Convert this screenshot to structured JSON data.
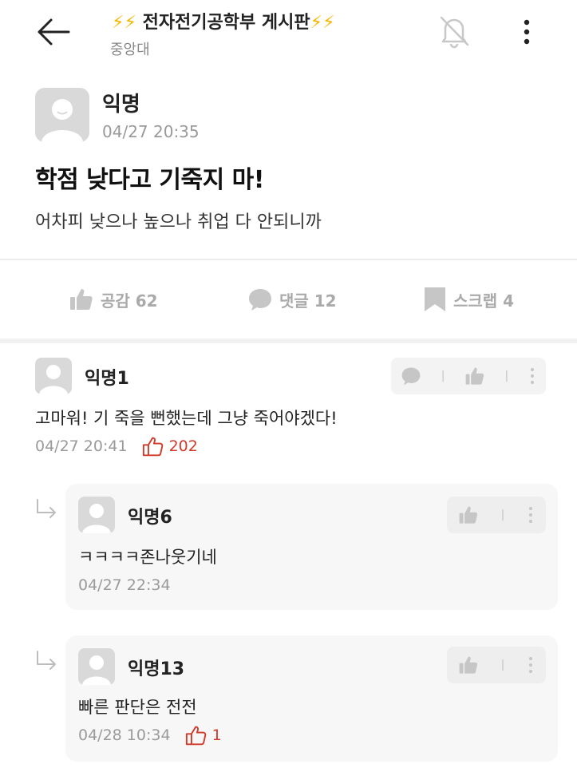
{
  "header": {
    "bolt": "⚡",
    "board_title": "전자전기공학부 게시판",
    "school": "중앙대"
  },
  "post": {
    "author": "익명",
    "time": "04/27 20:35",
    "title": "학점 낮다고 기죽지 마!",
    "body": "어차피 낮으나 높으나 취업 다 안되니까"
  },
  "actions": {
    "like": "공감 62",
    "comment": "댓글 12",
    "scrap": "스크랩 4"
  },
  "comments": [
    {
      "author": "익명1",
      "text": "고마워! 기 죽을 뻔했는데 그냥 죽어야겠다!",
      "time": "04/27 20:41",
      "likes": "202",
      "replies": [
        {
          "author": "익명6",
          "text": "ㅋㅋㅋㅋ존나웃기네",
          "time": "04/27 22:34"
        },
        {
          "author": "익명13",
          "text": "빠른 판단은 전전",
          "time": "04/28 10:34",
          "likes": "1"
        }
      ]
    }
  ],
  "colors": {
    "accent_like": "#d23a2a",
    "bolt": "#f5b700",
    "muted": "#9a9a9a"
  }
}
